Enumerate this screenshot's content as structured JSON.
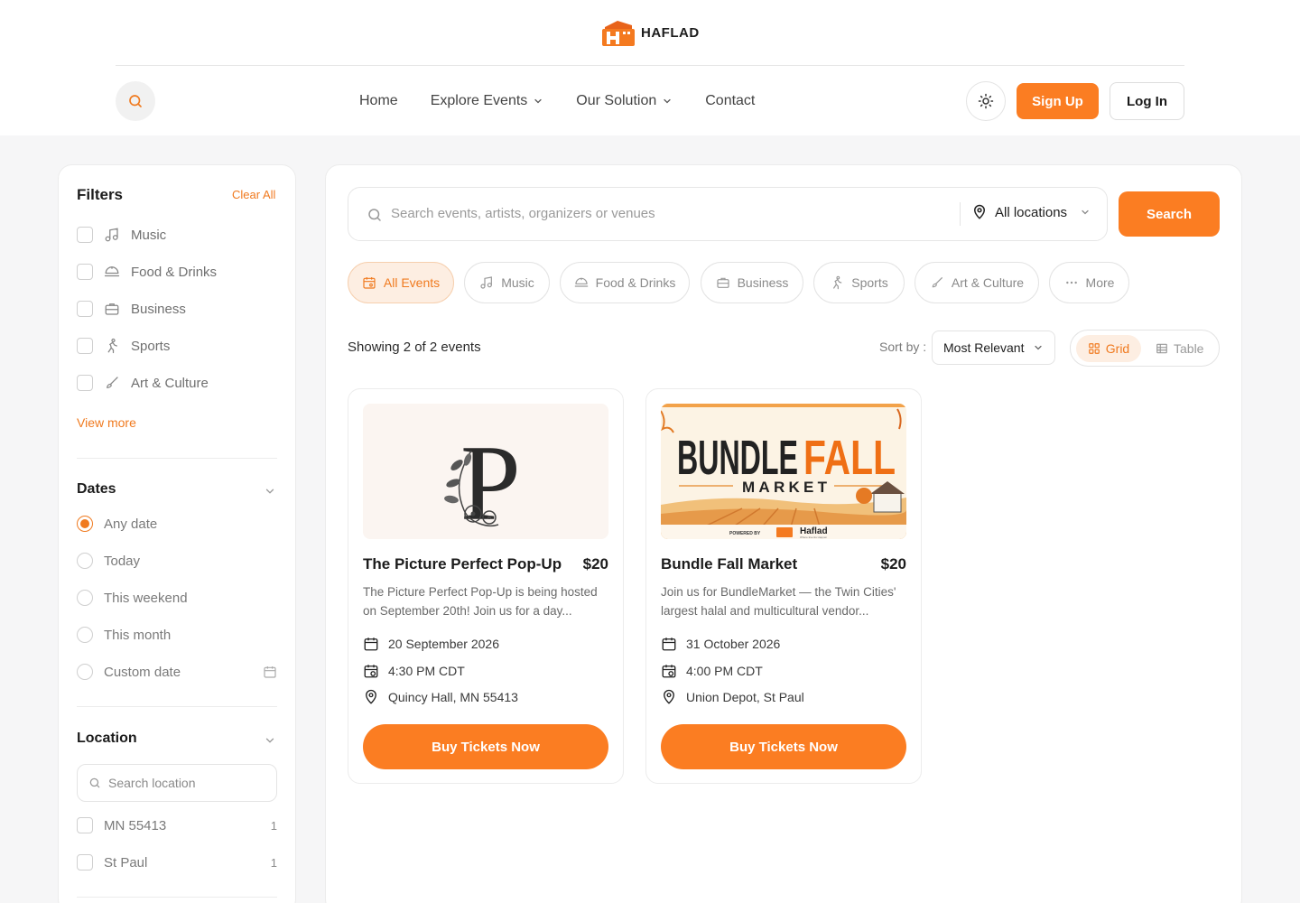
{
  "brand": {
    "name": "HAFLAD",
    "accent": "#fb7d22"
  },
  "nav": {
    "items": [
      {
        "label": "Home"
      },
      {
        "label": "Explore Events"
      },
      {
        "label": "Our Solution"
      },
      {
        "label": "Contact"
      }
    ],
    "signup": "Sign Up",
    "login": "Log In"
  },
  "filters": {
    "title": "Filters",
    "clear_all": "Clear All",
    "categories": [
      {
        "label": "Music",
        "icon": "music-note-icon"
      },
      {
        "label": "Food & Drinks",
        "icon": "food-icon"
      },
      {
        "label": "Business",
        "icon": "briefcase-icon"
      },
      {
        "label": "Sports",
        "icon": "running-icon"
      },
      {
        "label": "Art & Culture",
        "icon": "brush-icon"
      }
    ],
    "view_more": "View more",
    "dates": {
      "title": "Dates",
      "options": [
        "Any date",
        "Today",
        "This weekend",
        "This month",
        "Custom date"
      ],
      "selected": "Any date"
    },
    "location": {
      "title": "Location",
      "search_placeholder": "Search location",
      "options": [
        {
          "label": "MN 55413",
          "count": "1"
        },
        {
          "label": "St Paul",
          "count": "1"
        }
      ]
    }
  },
  "search": {
    "placeholder": "Search events, artists, organizers or venues",
    "location": "All locations",
    "button": "Search"
  },
  "category_pills": [
    {
      "label": "All Events",
      "active": true
    },
    {
      "label": "Music"
    },
    {
      "label": "Food & Drinks"
    },
    {
      "label": "Business"
    },
    {
      "label": "Sports"
    },
    {
      "label": "Art & Culture"
    },
    {
      "label": "More"
    }
  ],
  "results": {
    "showing": "Showing 2 of 2 events",
    "sort_label": "Sort by :",
    "sort_value": "Most Relevant",
    "view_grid": "Grid",
    "view_table": "Table"
  },
  "events": [
    {
      "title": "The Picture Perfect Pop-Up",
      "price": "$20",
      "description": "The Picture Perfect Pop-Up is being hosted on September 20th! Join us for a day...",
      "date": "20 September 2026",
      "time": "4:30 PM CDT",
      "venue": "Quincy Hall, MN 55413",
      "image_letter": "P",
      "cta": "Buy Tickets Now"
    },
    {
      "title": "Bundle Fall Market",
      "price": "$20",
      "description": "Join us for BundleMarket — the Twin Cities' largest halal and multicultural vendor...",
      "date": "31 October 2026",
      "time": "4:00 PM CDT",
      "venue": "Union Depot, St Paul",
      "image_line1a": "BUNDLE",
      "image_line1b": "FALL",
      "image_line2": "MARKET",
      "image_powered": "POWERED BY",
      "image_brand": "Haflad",
      "image_tagline": "Where Events Happen",
      "cta": "Buy Tickets Now"
    }
  ]
}
